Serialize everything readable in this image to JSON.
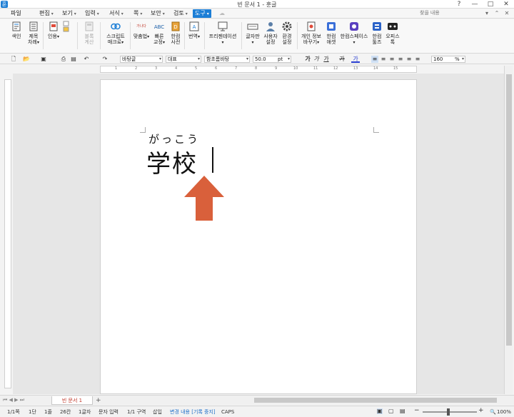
{
  "window": {
    "title": "빈 문서 1 - 훈글",
    "app_icon": "훈"
  },
  "menu": {
    "items": [
      "파일",
      "편집",
      "보기",
      "입력",
      "서식",
      "쪽",
      "보안",
      "검토",
      "도구"
    ],
    "active": "도구",
    "search_placeholder": "찾을 내용"
  },
  "ribbon": {
    "items": [
      {
        "l1": "색인",
        "l2": ""
      },
      {
        "l1": "제목",
        "l2": "차례"
      },
      {
        "l1": "인용",
        "l2": ""
      },
      {
        "l1": "블록",
        "l2": "계산"
      },
      {
        "l1": "스크립트",
        "l2": "매크로"
      },
      {
        "l1": "맞춤법",
        "l2": ""
      },
      {
        "l1": "빠른",
        "l2": "교정"
      },
      {
        "l1": "한컴",
        "l2": "사전"
      },
      {
        "l1": "번역",
        "l2": ""
      },
      {
        "l1": "프리젠테이션",
        "l2": ""
      },
      {
        "l1": "글자판",
        "l2": ""
      },
      {
        "l1": "사용자",
        "l2": "설정"
      },
      {
        "l1": "환경",
        "l2": "설정"
      },
      {
        "l1": "개인 정보",
        "l2": "바꾸기"
      },
      {
        "l1": "한컴",
        "l2": "애셋"
      },
      {
        "l1": "한컴스페이스",
        "l2": ""
      },
      {
        "l1": "한컴",
        "l2": "툴즈"
      },
      {
        "l1": "오피스",
        "l2": "톡"
      }
    ],
    "spell_icon_text": "가나다",
    "abc_icon_text": "ABC"
  },
  "format": {
    "style": "바탕글",
    "lang": "대표",
    "font": "함초롬바탕",
    "size": "50.0",
    "unit": "pt",
    "bold": "가",
    "italic": "가",
    "underline": "가",
    "strike": "가",
    "color": "가",
    "zoom": "160",
    "zoom_unit": "%"
  },
  "ruler": {
    "marks": [
      "1",
      "2",
      "3",
      "4",
      "5",
      "6",
      "7",
      "8",
      "9",
      "10",
      "11",
      "12",
      "13",
      "14",
      "15"
    ]
  },
  "document": {
    "furigana": "がっこう",
    "text": "学校"
  },
  "tabs": {
    "current": "빈 문서 1",
    "add": "+"
  },
  "status": {
    "page": "1/1쪽",
    "section": "1단",
    "line": "1줄",
    "col": "26칸",
    "chars": "1글자",
    "mode": "문자 입력",
    "area": "1/1 구역",
    "insert": "삽입",
    "track": "변경 내용 [기록 중지]",
    "caps": "CAPS",
    "zoom": "100%"
  },
  "colors": {
    "accent": "#1c7ed6",
    "arrow": "#d9603b",
    "tab_text": "#c0392b"
  }
}
